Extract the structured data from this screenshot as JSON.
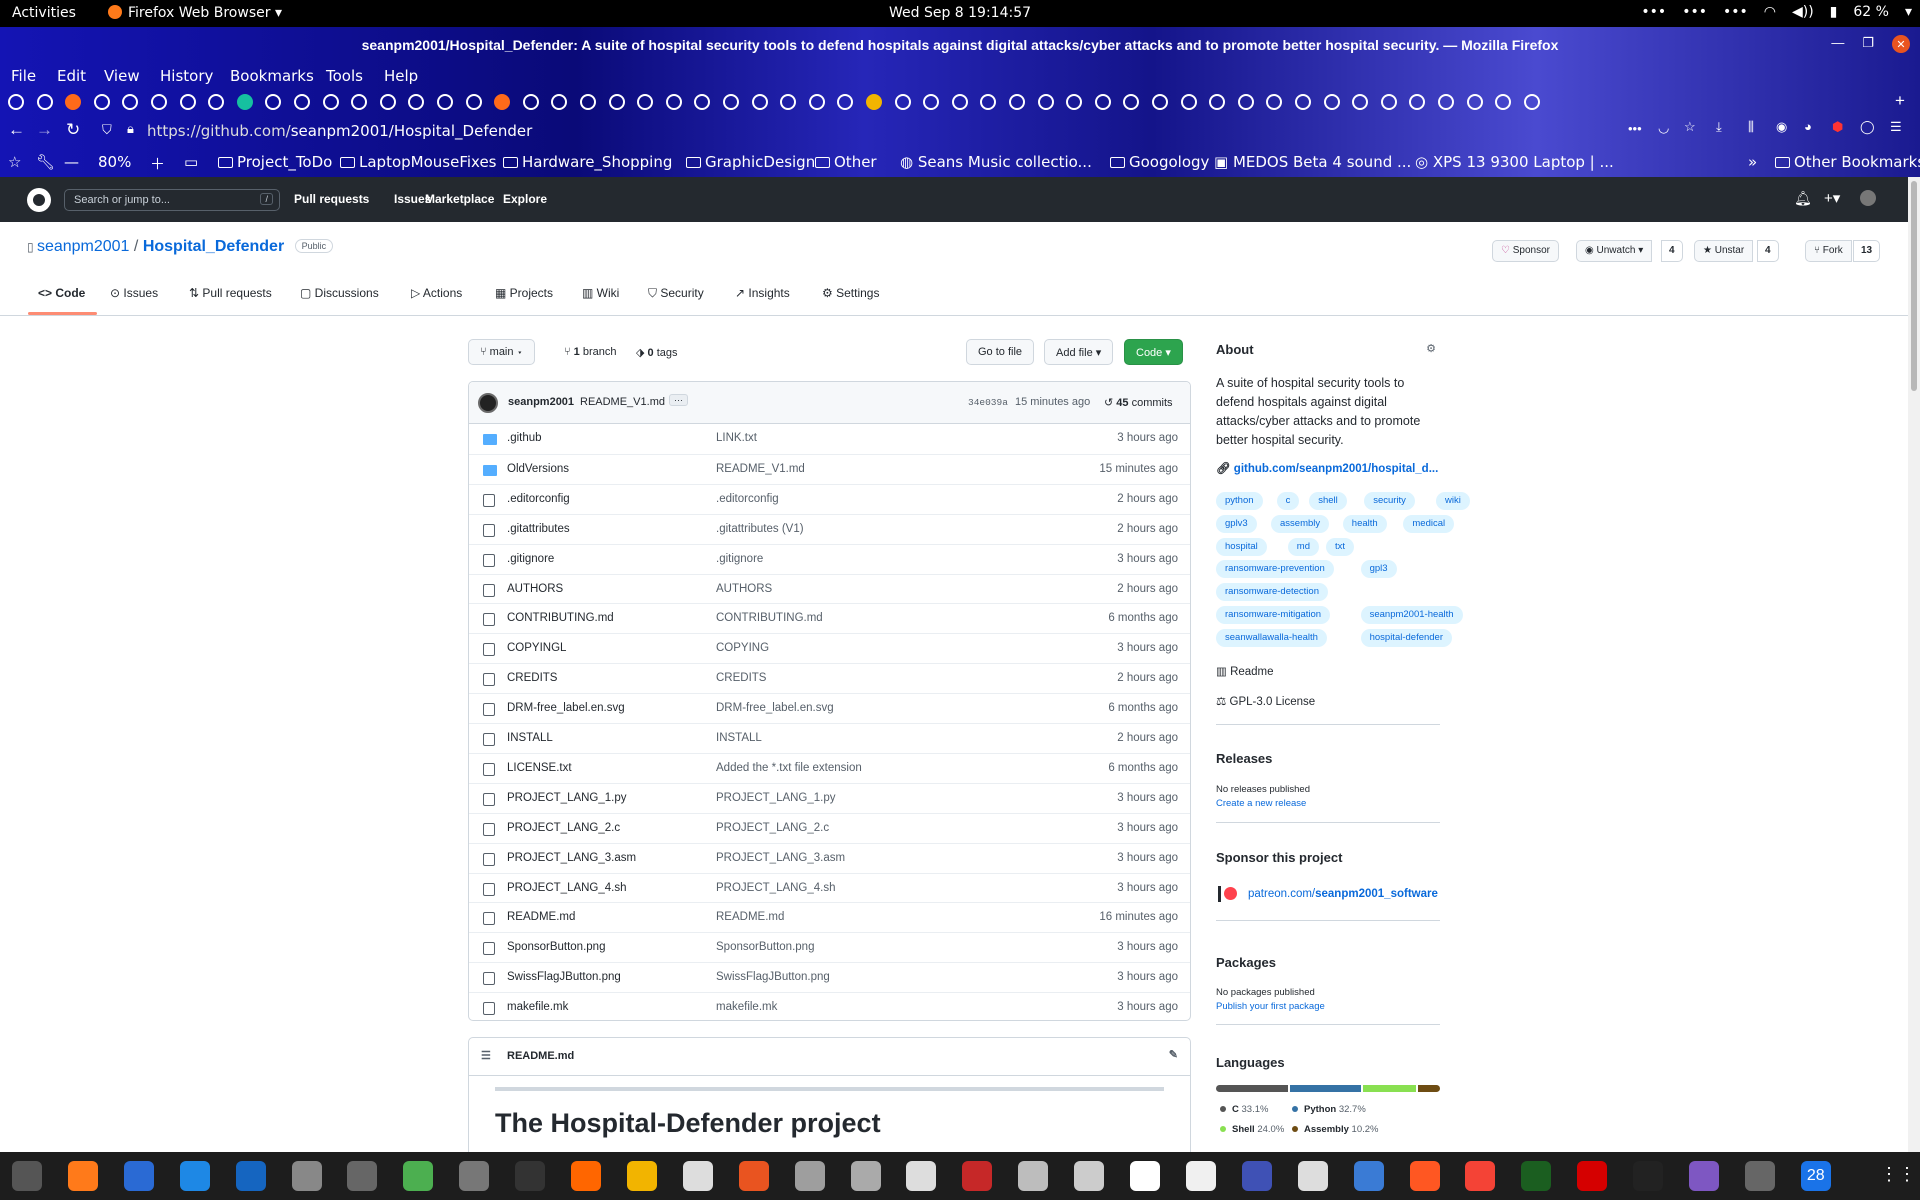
{
  "system": {
    "activities": "Activities",
    "app_name": "Firefox Web Browser",
    "clock": "Wed Sep 8  19:14:57",
    "battery": "62 %"
  },
  "window": {
    "title": "seanpm2001/Hospital_Defender: A suite of hospital security tools to defend hospitals against digital attacks/cyber attacks and to promote better hospital security. — Mozilla Firefox"
  },
  "menu": [
    "File",
    "Edit",
    "View",
    "History",
    "Bookmarks",
    "Tools",
    "Help"
  ],
  "nav": {
    "url_prefix": "https://github.com/",
    "url_path": "seanpm2001/Hospital_Defender",
    "zoom": "80%"
  },
  "bookmarks": [
    "Project_ToDo",
    "LaptopMouseFixes",
    "Hardware_Shopping",
    "GraphicDesign",
    "Other",
    "Seans Music collectio...",
    "Googology",
    "MEDOS Beta 4 sound ...",
    "XPS 13 9300 Laptop | ...",
    "Other Bookmarks"
  ],
  "github": {
    "search_placeholder": "Search or jump to...",
    "search_key": "/",
    "nav": [
      "Pull requests",
      "Issues",
      "Marketplace",
      "Explore"
    ]
  },
  "repo": {
    "owner": "seanpm2001",
    "sep": "/",
    "name": "Hospital_Defender",
    "visibility": "Public",
    "sponsor": "Sponsor",
    "watch": "Unwatch",
    "watch_count": "4",
    "star": "Unstar",
    "star_count": "4",
    "fork": "Fork",
    "fork_count": "13",
    "tabs": [
      "Code",
      "Issues",
      "Pull requests",
      "Discussions",
      "Actions",
      "Projects",
      "Wiki",
      "Security",
      "Insights",
      "Settings"
    ]
  },
  "code": {
    "branch": "main",
    "branches_n": "1",
    "branches_label": "branch",
    "tags_n": "0",
    "tags_label": "tags",
    "go_to_file": "Go to file",
    "add_file": "Add file",
    "code_btn": "Code",
    "commit": {
      "author": "seanpm2001",
      "message": "README_V1.md",
      "ellipsis": "···",
      "hash": "34e039a",
      "time": "15 minutes ago",
      "count": "45",
      "count_label": "commits"
    },
    "files": [
      {
        "name": ".github",
        "msg": "LINK.txt",
        "time": "3 hours ago",
        "dir": true
      },
      {
        "name": "OldVersions",
        "msg": "README_V1.md",
        "time": "15 minutes ago",
        "dir": true
      },
      {
        "name": ".editorconfig",
        "msg": ".editorconfig",
        "time": "2 hours ago"
      },
      {
        "name": ".gitattributes",
        "msg": ".gitattributes (V1)",
        "time": "2 hours ago"
      },
      {
        "name": ".gitignore",
        "msg": ".gitignore",
        "time": "3 hours ago"
      },
      {
        "name": "AUTHORS",
        "msg": "AUTHORS",
        "time": "2 hours ago"
      },
      {
        "name": "CONTRIBUTING.md",
        "msg": "CONTRIBUTING.md",
        "time": "6 months ago"
      },
      {
        "name": "COPYINGL",
        "msg": "COPYING",
        "time": "3 hours ago"
      },
      {
        "name": "CREDITS",
        "msg": "CREDITS",
        "time": "2 hours ago"
      },
      {
        "name": "DRM-free_label.en.svg",
        "msg": "DRM-free_label.en.svg",
        "time": "6 months ago"
      },
      {
        "name": "INSTALL",
        "msg": "INSTALL",
        "time": "2 hours ago"
      },
      {
        "name": "LICENSE.txt",
        "msg": "Added the *.txt file extension",
        "time": "6 months ago"
      },
      {
        "name": "PROJECT_LANG_1.py",
        "msg": "PROJECT_LANG_1.py",
        "time": "3 hours ago"
      },
      {
        "name": "PROJECT_LANG_2.c",
        "msg": "PROJECT_LANG_2.c",
        "time": "3 hours ago"
      },
      {
        "name": "PROJECT_LANG_3.asm",
        "msg": "PROJECT_LANG_3.asm",
        "time": "3 hours ago"
      },
      {
        "name": "PROJECT_LANG_4.sh",
        "msg": "PROJECT_LANG_4.sh",
        "time": "3 hours ago"
      },
      {
        "name": "README.md",
        "msg": "README.md",
        "time": "16 minutes ago"
      },
      {
        "name": "SponsorButton.png",
        "msg": "SponsorButton.png",
        "time": "3 hours ago"
      },
      {
        "name": "SwissFlagJButton.png",
        "msg": "SwissFlagJButton.png",
        "time": "3 hours ago"
      },
      {
        "name": "makefile.mk",
        "msg": "makefile.mk",
        "time": "3 hours ago"
      }
    ],
    "readme_file": "README.md",
    "readme_heading": "The Hospital-Defender project"
  },
  "about": {
    "heading": "About",
    "description": "A suite of hospital security tools to defend hospitals against digital attacks/cyber attacks and to promote better hospital security.",
    "link": "github.com/seanpm2001/hospital_d...",
    "topics": [
      "python",
      "c",
      "shell",
      "security",
      "wiki",
      "gplv3",
      "assembly",
      "health",
      "medical",
      "hospital",
      "md",
      "txt",
      "ransomware-prevention",
      "gpl3",
      "ransomware-detection",
      "ransomware-mitigation",
      "seanpm2001-health",
      "seanwallawalla-health",
      "hospital-defender"
    ],
    "readme": "Readme",
    "license": "GPL-3.0 License"
  },
  "releases": {
    "heading": "Releases",
    "none": "No releases published",
    "create": "Create a new release"
  },
  "sponsor_section": {
    "heading": "Sponsor this project",
    "link_prefix": "patreon.com/",
    "link_user": "seanpm2001_software"
  },
  "packages": {
    "heading": "Packages",
    "none": "No packages published",
    "publish": "Publish your first package"
  },
  "languages": {
    "heading": "Languages",
    "items": [
      {
        "name": "C",
        "pct": 33.1,
        "label": "33.1%",
        "color": "#555555"
      },
      {
        "name": "Python",
        "pct": 32.7,
        "label": "32.7%",
        "color": "#3572A5"
      },
      {
        "name": "Shell",
        "pct": 24.0,
        "label": "24.0%",
        "color": "#89e051"
      },
      {
        "name": "Assembly",
        "pct": 10.2,
        "label": "10.2%",
        "color": "#6E4C13"
      }
    ]
  },
  "dock": {
    "calendar_day": "28"
  }
}
